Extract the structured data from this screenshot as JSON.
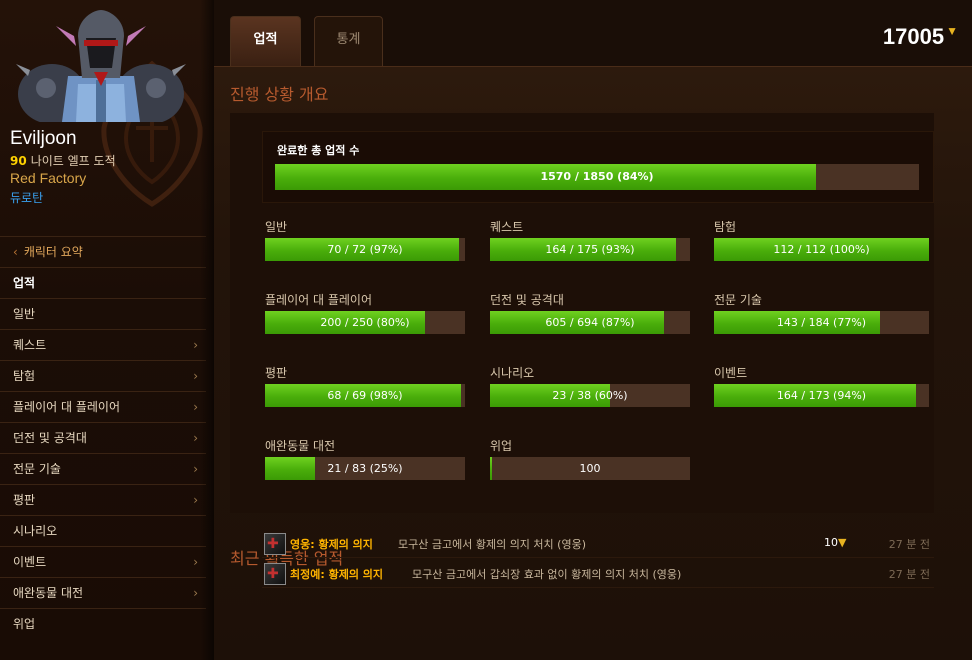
{
  "character": {
    "name": "Eviljoon",
    "level": "90",
    "race_class": "나이트 엘프 도적",
    "guild": "Red Factory",
    "realm": "듀로탄"
  },
  "nav": {
    "back_label": "캐릭터 요약",
    "active_label": "업적",
    "items": [
      {
        "label": "일반",
        "has_arrow": false
      },
      {
        "label": "퀘스트",
        "has_arrow": true
      },
      {
        "label": "탐험",
        "has_arrow": true
      },
      {
        "label": "플레이어 대 플레이어",
        "has_arrow": true
      },
      {
        "label": "던전 및 공격대",
        "has_arrow": true
      },
      {
        "label": "전문 기술",
        "has_arrow": true
      },
      {
        "label": "평판",
        "has_arrow": true
      },
      {
        "label": "시나리오",
        "has_arrow": false
      },
      {
        "label": "이벤트",
        "has_arrow": true
      },
      {
        "label": "애완동물 대전",
        "has_arrow": true
      },
      {
        "label": "위업",
        "has_arrow": false
      }
    ]
  },
  "tabs": {
    "achievements": "업적",
    "statistics": "통계"
  },
  "points": "17005",
  "overview": {
    "title": "진행 상황 개요",
    "total": {
      "label": "완료한 총 업적 수",
      "text": "1570 / 1850 (84%)",
      "fraction": 0.84
    },
    "categories": [
      {
        "label": "일반",
        "text": "70 / 72 (97%)",
        "fraction": 0.97
      },
      {
        "label": "퀘스트",
        "text": "164 / 175 (93%)",
        "fraction": 0.93
      },
      {
        "label": "탐험",
        "text": "112 / 112 (100%)",
        "fraction": 1.0
      },
      {
        "label": "플레이어 대 플레이어",
        "text": "200 / 250 (80%)",
        "fraction": 0.8
      },
      {
        "label": "던전 및 공격대",
        "text": "605 / 694 (87%)",
        "fraction": 0.87
      },
      {
        "label": "전문 기술",
        "text": "143 / 184 (77%)",
        "fraction": 0.77
      },
      {
        "label": "평판",
        "text": "68 / 69 (98%)",
        "fraction": 0.98
      },
      {
        "label": "시나리오",
        "text": "23 / 38 (60%)",
        "fraction": 0.6
      },
      {
        "label": "이벤트",
        "text": "164 / 173 (94%)",
        "fraction": 0.94
      },
      {
        "label": "애완동물 대전",
        "text": "21 / 83 (25%)",
        "fraction": 0.25
      },
      {
        "label": "위업",
        "text": "100",
        "fraction": 0.01
      }
    ]
  },
  "recent": {
    "title": "최근 획득한 업적",
    "items": [
      {
        "name": "영웅: 황제의 의지",
        "desc": "모구산 금고에서 황제의 의지 처치 (영웅)",
        "points": "10",
        "time": "27 분 전"
      },
      {
        "name": "최정예: 황제의 의지",
        "desc": "모구산 금고에서 갑쇠장 효과 없이 황제의 의지 처치 (영웅)",
        "points": "",
        "time": "27 분 전"
      }
    ]
  },
  "colors": {
    "bar_fill": "#4aae0b",
    "bar_track": "#4a3224",
    "section_title": "#b65a2e",
    "achievement_name": "#ffb400",
    "realm_link": "#3aa1f0"
  },
  "icons": {
    "back": "chevron-left-icon",
    "submenu": "chevron-right-icon",
    "points": "shield-icon",
    "achievement": "achievement-icon"
  }
}
